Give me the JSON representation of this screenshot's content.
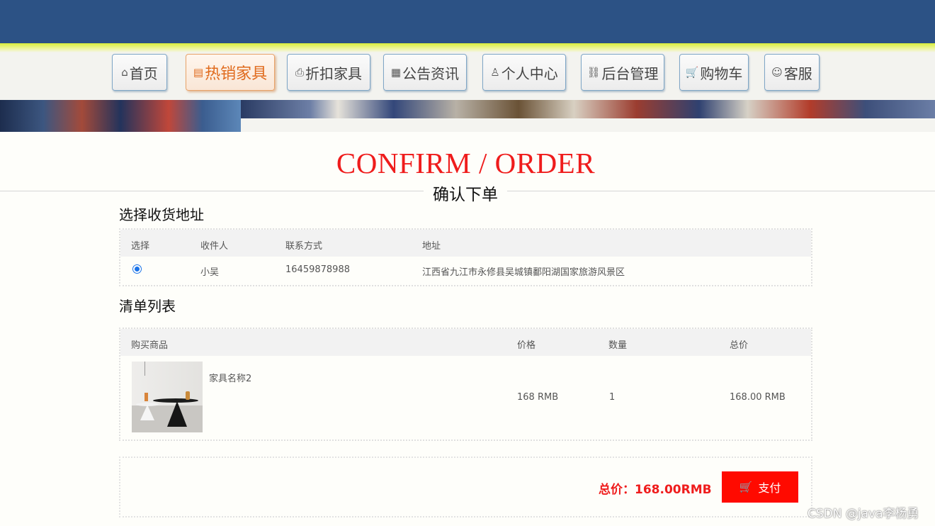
{
  "nav": {
    "items": [
      {
        "icon": "⌂",
        "label": "首页"
      },
      {
        "icon": "▤",
        "label": "热销家具",
        "active": true
      },
      {
        "icon": "⎙",
        "label": "折扣家具"
      },
      {
        "icon": "▦",
        "label": "公告资讯"
      },
      {
        "icon": "♙",
        "label": "个人中心"
      },
      {
        "icon": "⛓",
        "label": "后台管理"
      },
      {
        "icon": "🛒",
        "label": "购物车"
      },
      {
        "icon": "☺",
        "label": "客服"
      }
    ]
  },
  "page": {
    "headline": "CONFIRM / ORDER",
    "subheading": "确认下单"
  },
  "address_section": {
    "title": "选择收货地址",
    "columns": [
      "选择",
      "收件人",
      "联系方式",
      "地址"
    ],
    "rows": [
      {
        "selected": true,
        "recipient": "小吴",
        "phone": "16459878988",
        "address": "江西省九江市永修县吴城镇鄱阳湖国家旅游风景区"
      }
    ]
  },
  "order_section": {
    "title": "清单列表",
    "columns": [
      "购买商品",
      "价格",
      "数量",
      "总价"
    ],
    "items": [
      {
        "name": "家具名称2",
        "price": "168 RMB",
        "quantity": "1",
        "subtotal": "168.00 RMB"
      }
    ]
  },
  "payment": {
    "total_label": "总价：168.00RMB",
    "pay_button": "支付"
  },
  "watermark": "CSDN @java李杨勇",
  "colors": {
    "header_blue": "#2c5285",
    "accent_red": "#ef1c1c",
    "pay_button": "#ff0a00",
    "active_tab": "#e06a1c"
  }
}
